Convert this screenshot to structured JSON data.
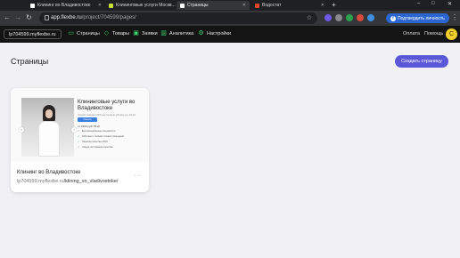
{
  "browser": {
    "tabs": [
      {
        "title": "Клининг во Владивостоке",
        "favicon_color": "#ffffff",
        "active": false
      },
      {
        "title": "Клининговые услуги Москв...",
        "favicon_color": "#c7e03a",
        "active": false
      },
      {
        "title": "Страницы",
        "favicon_color": "#ffffff",
        "active": true
      },
      {
        "title": "Водостат",
        "favicon_color": "#e0452b",
        "active": false
      }
    ],
    "new_tab": "+",
    "window_controls": [
      "–",
      "□",
      "✕"
    ],
    "url_host": "app.flexbe.ru",
    "url_path": "/project/704599/pages/",
    "verify_label": "Подтвердить личность"
  },
  "app": {
    "project_name": "lp704599.myflexbe.ru",
    "nav": [
      {
        "label": "Страницы",
        "icon": "pages-icon"
      },
      {
        "label": "Товары",
        "icon": "tag-icon"
      },
      {
        "label": "Заявки",
        "icon": "inbox-icon"
      },
      {
        "label": "Аналитика",
        "icon": "chart-icon"
      },
      {
        "label": "Настройки",
        "icon": "gear-icon"
      }
    ],
    "payment_label": "Оплата",
    "help_label": "Помощь",
    "avatar_letter": "С"
  },
  "main": {
    "title": "Страницы",
    "create_button": "Создать страницу",
    "page_card": {
      "title": "Клининг во Владивостоке",
      "url_domain": "lp704599.myflexbe.ru",
      "url_slug": "/klining_vo_vladivostoke/",
      "menu": "···",
      "thumbnail": {
        "heading": "Клининговые услуги во Владивостоке",
        "subtitle": "Акция! Скидка 20% на первую уборку до 10.10",
        "button": "Узнать стоимость",
        "price": "от 1500 руб/ 75 м²",
        "features": [
          "Бесплатный выезд специалиста",
          "Работаем с любыми типами помещений",
          "Гарантия качества 100%",
          "Скидки постоянным клиентам"
        ]
      }
    }
  }
}
